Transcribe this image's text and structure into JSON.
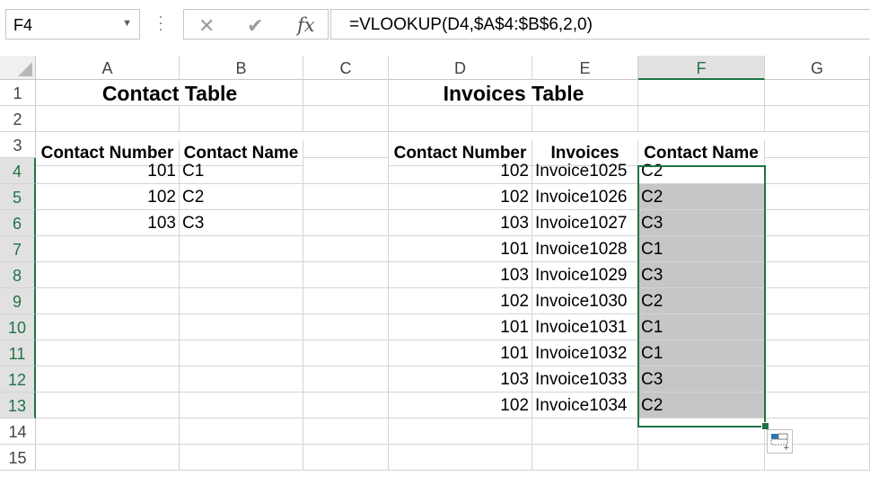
{
  "name_box": "F4",
  "formula": "=VLOOKUP(D4,$A$4:$B$6,2,0)",
  "icons": {
    "cancel": "cancel-x-icon",
    "enter": "enter-check-icon",
    "function": "fx-icon"
  },
  "fx_label": "fx",
  "columns": [
    "A",
    "B",
    "C",
    "D",
    "E",
    "F",
    "G"
  ],
  "rows": [
    "1",
    "2",
    "3",
    "4",
    "5",
    "6",
    "7",
    "8",
    "9",
    "10",
    "11",
    "12",
    "13",
    "14",
    "15"
  ],
  "titles": {
    "contact": "Contact Table",
    "invoices": "Invoices Table"
  },
  "headers": {
    "a3": "Contact Number",
    "b3": "Contact Name",
    "d3": "Contact Number",
    "e3": "Invoices",
    "f3": "Contact Name"
  },
  "contacts": [
    {
      "number": "101",
      "name": "C1"
    },
    {
      "number": "102",
      "name": "C2"
    },
    {
      "number": "103",
      "name": "C3"
    }
  ],
  "invoices": [
    {
      "number": "102",
      "invoice": "Invoice1025",
      "name": "C2"
    },
    {
      "number": "102",
      "invoice": "Invoice1026",
      "name": "C2"
    },
    {
      "number": "103",
      "invoice": "Invoice1027",
      "name": "C3"
    },
    {
      "number": "101",
      "invoice": "Invoice1028",
      "name": "C1"
    },
    {
      "number": "103",
      "invoice": "Invoice1029",
      "name": "C3"
    },
    {
      "number": "102",
      "invoice": "Invoice1030",
      "name": "C2"
    },
    {
      "number": "101",
      "invoice": "Invoice1031",
      "name": "C1"
    },
    {
      "number": "101",
      "invoice": "Invoice1032",
      "name": "C1"
    },
    {
      "number": "103",
      "invoice": "Invoice1033",
      "name": "C3"
    },
    {
      "number": "102",
      "invoice": "Invoice1034",
      "name": "C2"
    }
  ],
  "colors": {
    "accent": "#217346",
    "selection_shade": "#c6c6c6",
    "gridline": "#d4d4d4"
  }
}
